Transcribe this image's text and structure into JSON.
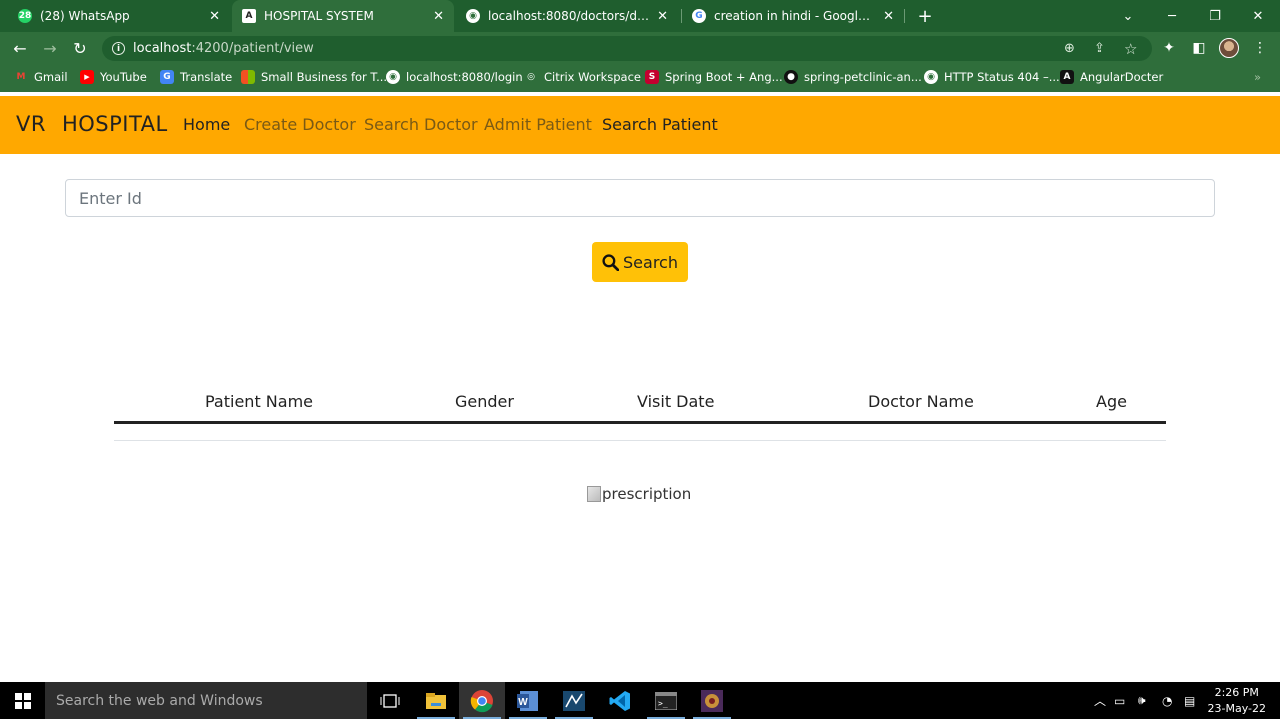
{
  "browser": {
    "tabs": [
      {
        "title": "(28) WhatsApp",
        "icon": "whatsapp-icon"
      },
      {
        "title": "HOSPITAL SYSTEM",
        "icon": "angular-icon"
      },
      {
        "title": "localhost:8080/doctors/doc/%7B",
        "icon": "globe-icon"
      },
      {
        "title": "creation in hindi - Google Search",
        "icon": "google-icon"
      }
    ],
    "url_host": "localhost",
    "url_path": ":4200/patient/view",
    "bookmarks": [
      {
        "label": "Gmail",
        "icon": "gmail-icon"
      },
      {
        "label": "YouTube",
        "icon": "youtube-icon"
      },
      {
        "label": "Translate",
        "icon": "translate-icon"
      },
      {
        "label": "Small Business for T...",
        "icon": "microsoft-icon"
      },
      {
        "label": "localhost:8080/login",
        "icon": "globe-icon"
      },
      {
        "label": "Citrix Workspace",
        "icon": "citrix-icon"
      },
      {
        "label": "Spring Boot + Ang...",
        "icon": "spring-icon"
      },
      {
        "label": "spring-petclinic-an...",
        "icon": "github-icon"
      },
      {
        "label": "HTTP Status 404 –...",
        "icon": "globe-icon"
      },
      {
        "label": "AngularDocter",
        "icon": "angular-icon"
      }
    ]
  },
  "app": {
    "brand_vr": "VR",
    "brand_name": "HOSPITAL",
    "nav": [
      "Home",
      "Create Doctor",
      "Search Doctor",
      "Admit Patient",
      "Search Patient"
    ],
    "search_placeholder": "Enter Id",
    "search_button": "Search",
    "table_headers": [
      "Patient Name",
      "Gender",
      "Visit Date",
      "Doctor Name",
      "Age"
    ],
    "image_alt": "prescription"
  },
  "taskbar": {
    "search_placeholder": "Search the web and Windows",
    "time": "2:26 PM",
    "date": "23-May-22"
  },
  "colors": {
    "browser_frame": "#2f6e3b",
    "navbar": "#ffa800",
    "search_button": "#ffc107"
  }
}
